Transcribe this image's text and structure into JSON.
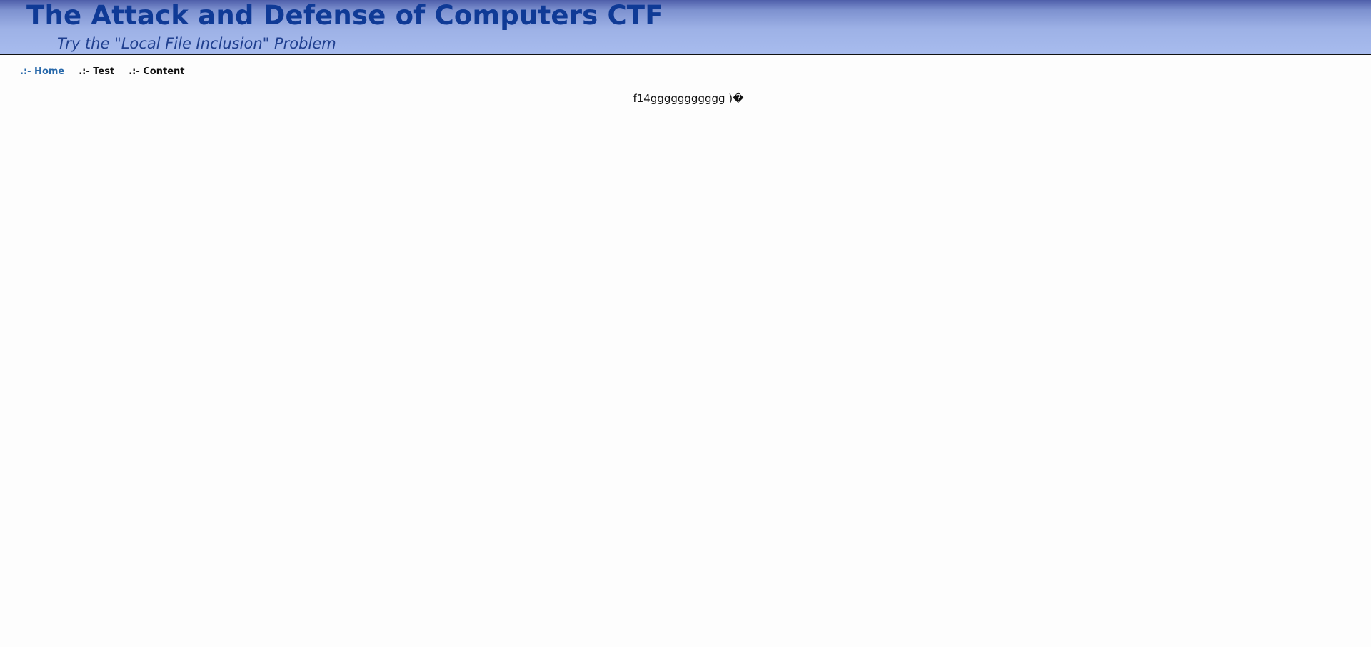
{
  "header": {
    "title": "The Attack and Defense of Computers CTF",
    "subtitle": "Try the \"Local File Inclusion\" Problem"
  },
  "nav": {
    "items": [
      {
        "label": ".:- Home"
      },
      {
        "label": ".:- Test"
      },
      {
        "label": ".:- Content"
      }
    ]
  },
  "main": {
    "output_text": "f14ggggggggggg )�"
  },
  "colors": {
    "title": "#0f3a96",
    "active_nav": "#2a6aab",
    "header_gradient_top": "#4e5eaa",
    "header_gradient_bottom": "#a8bcee"
  }
}
